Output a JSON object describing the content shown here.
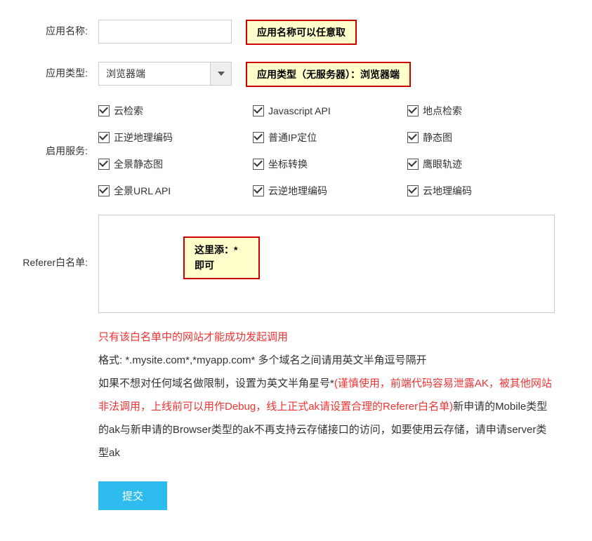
{
  "rows": {
    "appName": {
      "label": "应用名称:",
      "value": "",
      "hint": "应用名称可以任意取"
    },
    "appType": {
      "label": "应用类型:",
      "selected": "浏览器端",
      "hint": "应用类型（无服务器）：浏览器端"
    },
    "services": {
      "label": "启用服务:",
      "items": [
        {
          "label": "云检索",
          "checked": true
        },
        {
          "label": "Javascript API",
          "checked": true
        },
        {
          "label": "地点检索",
          "checked": true
        },
        {
          "label": "正逆地理编码",
          "checked": true
        },
        {
          "label": "普通IP定位",
          "checked": true
        },
        {
          "label": "静态图",
          "checked": true
        },
        {
          "label": "全景静态图",
          "checked": true
        },
        {
          "label": "坐标转换",
          "checked": true
        },
        {
          "label": "鹰眼轨迹",
          "checked": true
        },
        {
          "label": "全景URL API",
          "checked": true
        },
        {
          "label": "云逆地理编码",
          "checked": true
        },
        {
          "label": "云地理编码",
          "checked": true
        }
      ]
    },
    "referer": {
      "label": "Referer白名单:",
      "value": "",
      "hintLine1": "这里添：*",
      "hintLine2": "即可"
    }
  },
  "notes": {
    "l1": "只有该白名单中的网站才能成功发起调用",
    "l2": "格式:   *.mysite.com*,*myapp.com* 多个域名之间请用英文半角逗号隔开",
    "l3a": "如果不想对任何域名做限制，设置为英文半角星号*",
    "l3b": "(谨慎使用，前端代码容易泄露AK，被其他网站非法调用，上线前可以用作Debug，线上正式ak请设置合理的Referer白名单)",
    "l3c": "新申请的Mobile类型的ak与新申请的Browser类型的ak不再支持云存储接口的访问，如要使用云存储，请申请server类型ak"
  },
  "submit": "提交"
}
